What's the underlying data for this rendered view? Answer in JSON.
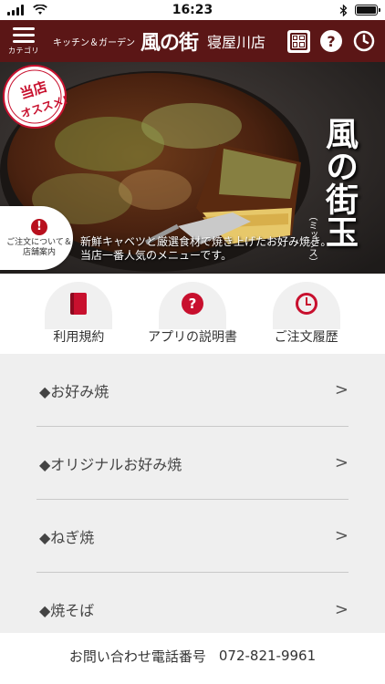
{
  "status_bar": {
    "time": "16:23"
  },
  "header": {
    "menu_label": "カテゴリ",
    "brand_sub": "キッチン＆ガーデン",
    "brand_logo": "風の街",
    "store_name": "寝屋川店",
    "seal_text": "風の街",
    "background_color": "#5b1616"
  },
  "hero": {
    "badge_text": "当店オススメ!",
    "title": "風の街玉",
    "title_sub": "（ミックス）",
    "caption_line1": "新鮮キャベツと厳選食材で焼き上げたお好み焼き。",
    "caption_line2": "当店一番人気のメニューです。",
    "store_tag": "ご注文について＆店舗案内"
  },
  "quick_links": [
    {
      "label": "利用規約",
      "icon": "book-icon"
    },
    {
      "label": "アプリの説明書",
      "icon": "help-icon"
    },
    {
      "label": "ご注文履歴",
      "icon": "clock-icon"
    }
  ],
  "menu_items": [
    {
      "label": "◆お好み焼"
    },
    {
      "label": "◆オリジナルお好み焼"
    },
    {
      "label": "◆ねぎ焼"
    },
    {
      "label": "◆焼そば"
    }
  ],
  "chevron": ">",
  "footer": {
    "label": "お問い合わせ電話番号",
    "phone": "072-821-9961"
  },
  "colors": {
    "accent_red": "#c8102e",
    "header_maroon": "#5b1616"
  }
}
